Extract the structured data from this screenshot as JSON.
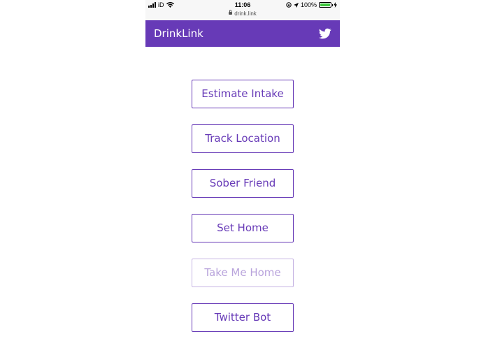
{
  "status_bar": {
    "carrier": "iD",
    "time": "11:06",
    "url": "drink.link",
    "battery_percent": "100%",
    "battery_level": 1.0,
    "icons": [
      "signal-icon",
      "wifi-icon",
      "lock-icon",
      "orientation-lock-icon",
      "location-icon",
      "battery-icon",
      "charging-icon"
    ]
  },
  "navbar": {
    "brand": "DrinkLink",
    "background": "#673ab7",
    "twitter_icon": "twitter-icon"
  },
  "buttons": [
    {
      "label": "Estimate Intake",
      "enabled": true
    },
    {
      "label": "Track Location",
      "enabled": true
    },
    {
      "label": "Sober Friend",
      "enabled": true
    },
    {
      "label": "Set Home",
      "enabled": true
    },
    {
      "label": "Take Me Home",
      "enabled": false
    },
    {
      "label": "Twitter Bot",
      "enabled": true
    }
  ],
  "colors": {
    "accent": "#673ab7",
    "disabled": "#b9a4dc"
  }
}
